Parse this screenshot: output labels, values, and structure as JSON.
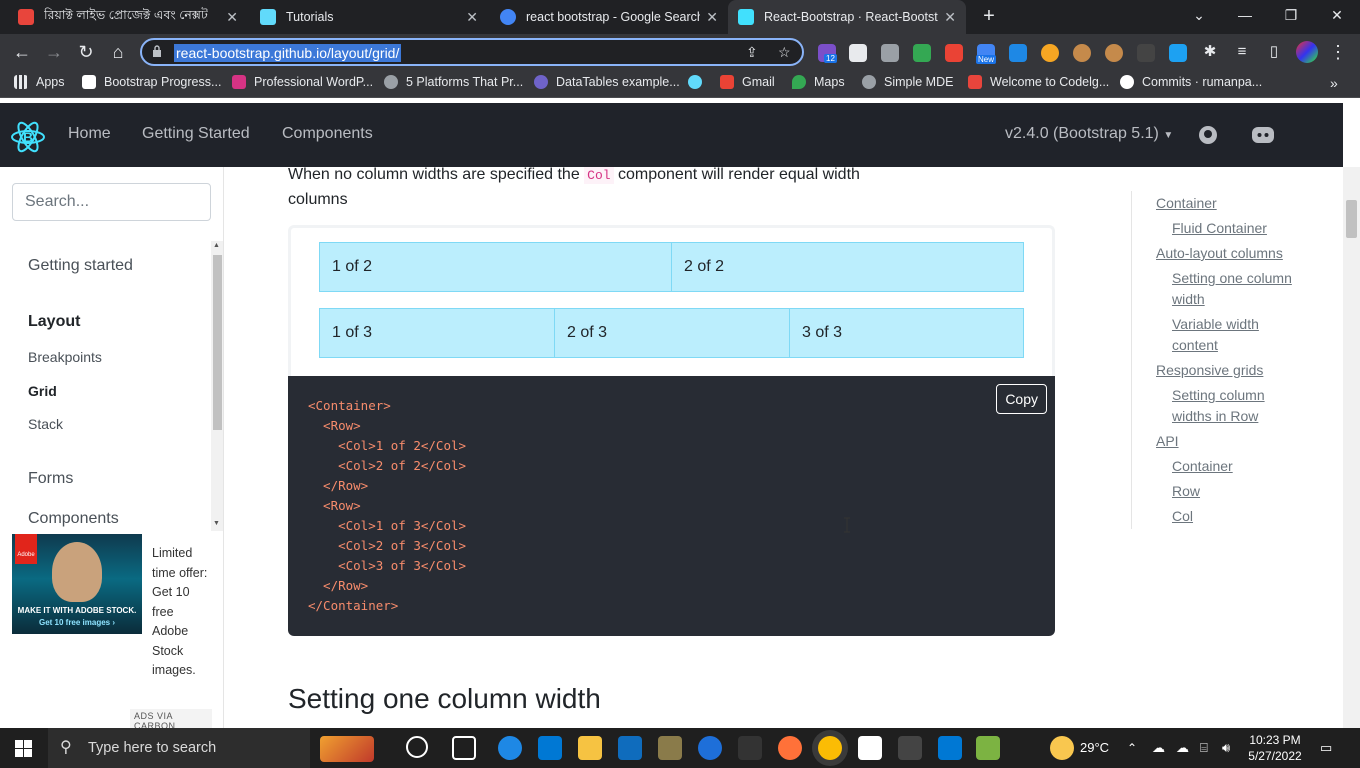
{
  "browser": {
    "tabs": [
      {
        "title": "রিয়াক্ট লাইভ প্রোজেক্ট এবং নেক্সট",
        "favicon_color": "#e8453c"
      },
      {
        "title": "Tutorials",
        "favicon_color": "#61dafb"
      },
      {
        "title": "react bootstrap - Google Search",
        "favicon_color": "#4285f4"
      },
      {
        "title": "React-Bootstrap · React-Bootstrap",
        "favicon_color": "#41e0fd"
      }
    ],
    "url": "react-bootstrap.github.io/layout/grid/",
    "ext_badge": "12",
    "ext_badge2": "New",
    "bookmarks": [
      "Apps",
      "Bootstrap Progress...",
      "Professional WordP...",
      "5 Platforms That Pr...",
      "DataTables example...",
      "Gmail",
      "Maps",
      "Simple MDE",
      "Welcome to Codelg...",
      "Commits · rumanpa..."
    ]
  },
  "site": {
    "nav": {
      "home": "Home",
      "getting_started": "Getting Started",
      "components": "Components",
      "version": "v2.4.0 (Bootstrap 5.1)"
    },
    "sidebar": {
      "search_placeholder": "Search...",
      "getting_started": "Getting started",
      "layout": "Layout",
      "breakpoints": "Breakpoints",
      "grid": "Grid",
      "stack": "Stack",
      "forms": "Forms",
      "components": "Components"
    },
    "ad": {
      "image_line1": "MAKE IT WITH ADOBE STOCK.",
      "image_line2": "Get 10 free images ›",
      "text": "Limited time offer: Get 10 free Adobe Stock images.",
      "via": "ADS VIA CARBON"
    },
    "content": {
      "intro_before": "When no column widths are specified the ",
      "intro_code": "Col",
      "intro_after": " component will render equal width columns",
      "row1": [
        "1 of 2",
        "2 of 2"
      ],
      "row2": [
        "1 of 3",
        "2 of 3",
        "3 of 3"
      ],
      "copy": "Copy",
      "code": "<Container>\n  <Row>\n    <Col>1 of 2</Col>\n    <Col>2 of 2</Col>\n  </Row>\n  <Row>\n    <Col>1 of 3</Col>\n    <Col>2 of 3</Col>\n    <Col>3 of 3</Col>\n  </Row>\n</Container>",
      "heading": "Setting one column width"
    },
    "toc": [
      "Container",
      "Fluid Container",
      "Auto-layout columns",
      "Setting one column width",
      "Variable width content",
      "Responsive grids",
      "Setting column widths in Row",
      "API",
      "Container",
      "Row",
      "Col"
    ]
  },
  "taskbar": {
    "search_placeholder": "Type here to search",
    "temp": "29°C",
    "time": "10:23 PM",
    "date": "5/27/2022"
  }
}
